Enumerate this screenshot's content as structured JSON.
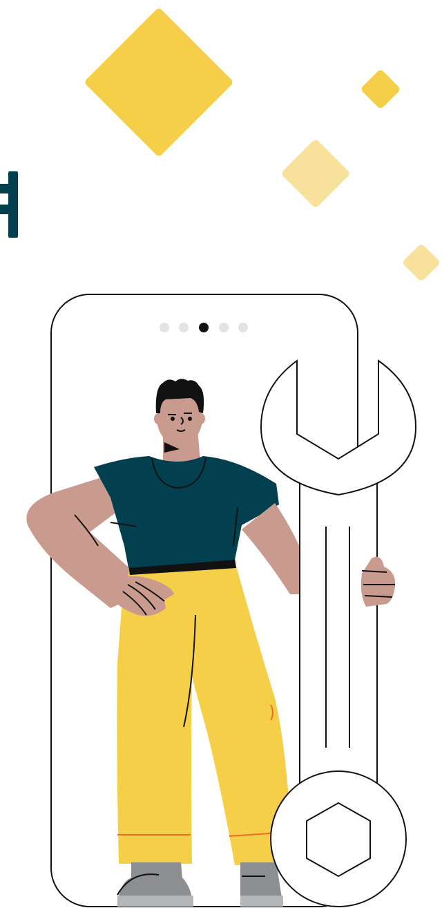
{
  "illustration": {
    "subject": "person-holding-wrench",
    "colors": {
      "accent_yellow": "#F5CF47",
      "accent_yellow_light": "#F8E19A",
      "shirt_teal": "#024050",
      "skin": "#C99A8E",
      "pants_yellow": "#F5CF47",
      "shoes_gray": "#8D8E90",
      "outline": "#111111",
      "logo_teal": "#024050",
      "hem_orange": "#F46A20"
    },
    "pager": {
      "total": 5,
      "active_index": 2,
      "active_color": "#111111",
      "inactive_color": "#E3E3E3"
    }
  }
}
